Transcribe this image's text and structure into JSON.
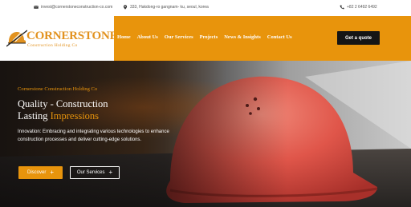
{
  "topbar": {
    "email": "invest@cornerstoneconstruction-co.com",
    "address": "333, Hakdong-ro gangnam- ku, seoul, korea",
    "phone": "+82 2 6492 6492"
  },
  "logo": {
    "name": "CORNERSTONE",
    "subtitle": "Construction Holding Co"
  },
  "nav": {
    "items": [
      "Home",
      "About Us",
      "Our Services",
      "Projects",
      "News & Insights",
      "Contact Us"
    ],
    "quote_button": "Get a quote"
  },
  "hero": {
    "kicker": "Cornerstone Construction Holding Co",
    "title_line1": "Quality - Construction",
    "title_line2_plain": "Lasting ",
    "title_line2_highlight": "Impressions",
    "description": "Innovation: Embracing and integrating various technologies to enhance construction processes and deliver cutting-edge solutions.",
    "discover_button": "Discover",
    "services_button": "Our Services"
  },
  "colors": {
    "accent": "#e8940c",
    "dark": "#151515"
  }
}
